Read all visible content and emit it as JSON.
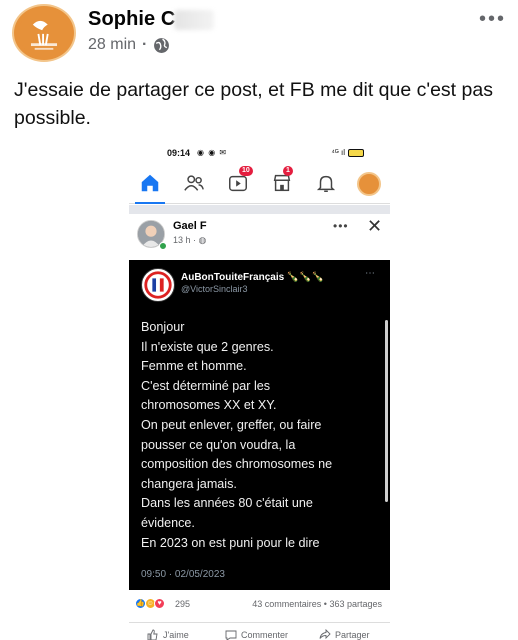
{
  "post": {
    "author": "Sophie C",
    "time": "28 min",
    "separator": "·",
    "text": "J'essaie de partager ce post, et FB me dit que c'est pas possible.",
    "more": "•••"
  },
  "screenshot": {
    "status_time": "09:14",
    "status_icons": "◉ ◉ ✉",
    "status_right": "⁴ᴳ ıl",
    "nav_badges": {
      "video": "10",
      "marketplace": "1"
    },
    "inner_post": {
      "author": "Gael F",
      "time": "13 h ·",
      "more": "•••",
      "close": "✕"
    },
    "tweet": {
      "name": "AuBonTouiteFrançais 🍾🍾🍾",
      "handle": "@VictorSinclair3",
      "more": "⋯",
      "lines": [
        "Bonjour",
        "Il n'existe que 2 genres.",
        "Femme et homme.",
        "C'est déterminé par les",
        "chromosomes XX et XY.",
        "On peut enlever, greffer, ou faire",
        "pousser ce qu'on voudra, la",
        "composition des chromosomes ne",
        "changera jamais.",
        "Dans les années 80 c'était une",
        "évidence.",
        "En 2023 on est puni pour le dire"
      ],
      "date": "09:50 · 02/05/2023"
    },
    "stats": {
      "reaction_count": "295",
      "comments_shares": "43 commentaires • 363 partages"
    },
    "actions": {
      "like": "J'aime",
      "comment": "Commenter",
      "share": "Partager"
    }
  },
  "colors": {
    "fb_blue": "#1877f2",
    "tweet_bg": "#000000",
    "badge_red": "#e41e3f",
    "avatar_orange": "#e6913a"
  }
}
